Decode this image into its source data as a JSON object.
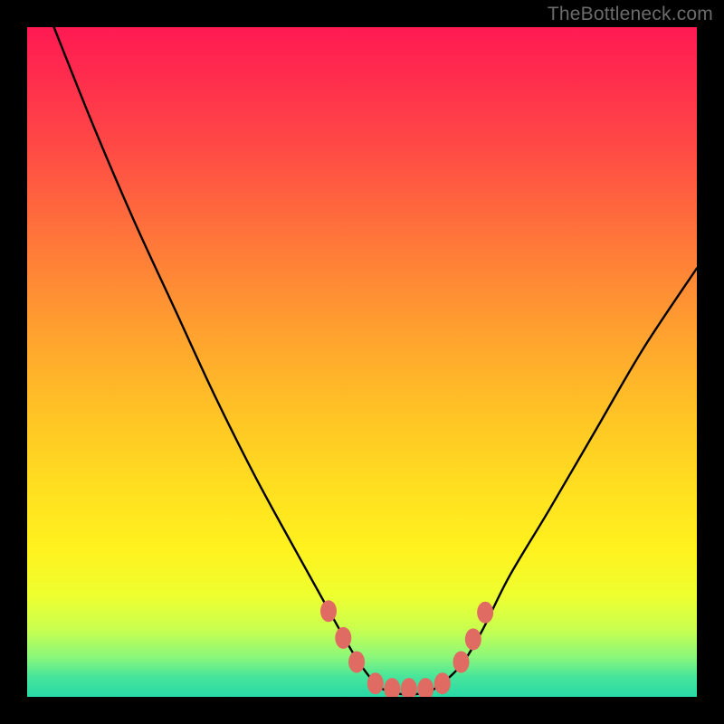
{
  "attribution": "TheBottleneck.com",
  "chart_data": {
    "type": "line",
    "title": "",
    "xlabel": "",
    "ylabel": "",
    "xlim": [
      0,
      100
    ],
    "ylim": [
      0,
      100
    ],
    "grid": false,
    "legend": false,
    "series": [
      {
        "name": "curve",
        "x": [
          4,
          10,
          16,
          22,
          28,
          34,
          40,
          45,
          49,
          52,
          54,
          56,
          58,
          60,
          62,
          65,
          68,
          72,
          78,
          85,
          92,
          100
        ],
        "y": [
          100,
          85,
          71,
          58,
          45,
          33,
          22,
          13,
          6,
          2,
          0.8,
          0.4,
          0.4,
          0.8,
          2,
          5,
          10,
          18,
          28,
          40,
          52,
          64
        ]
      }
    ],
    "markers": [
      {
        "name": "left-dot-1",
        "x": 45.0,
        "y": 12.8
      },
      {
        "name": "left-dot-2",
        "x": 47.2,
        "y": 8.8
      },
      {
        "name": "left-dot-3",
        "x": 49.2,
        "y": 5.2
      },
      {
        "name": "flat-dot-1",
        "x": 52.0,
        "y": 2.0
      },
      {
        "name": "flat-dot-2",
        "x": 54.5,
        "y": 1.2
      },
      {
        "name": "flat-dot-3",
        "x": 57.0,
        "y": 1.2
      },
      {
        "name": "flat-dot-4",
        "x": 59.5,
        "y": 1.2
      },
      {
        "name": "flat-dot-5",
        "x": 62.0,
        "y": 2.0
      },
      {
        "name": "right-dot-1",
        "x": 64.8,
        "y": 5.2
      },
      {
        "name": "right-dot-2",
        "x": 66.6,
        "y": 8.6
      },
      {
        "name": "right-dot-3",
        "x": 68.4,
        "y": 12.6
      }
    ],
    "colors": {
      "curve_stroke": "#000000",
      "marker_fill": "#e06b62",
      "gradient_top": "#ff1a52",
      "gradient_mid": "#ffd423",
      "gradient_bottom": "#28d9a6"
    }
  }
}
